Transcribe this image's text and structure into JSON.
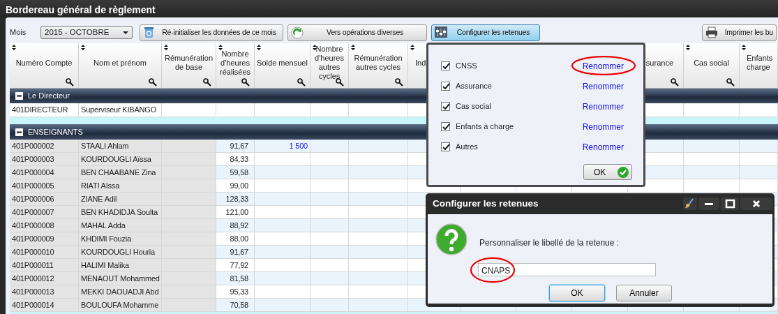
{
  "window": {
    "title": "Bordereau général de règlement"
  },
  "toolbar": {
    "month_label": "Mois",
    "month_value": "2015 - OCTOBRE",
    "buttons": [
      {
        "kind": "reset",
        "label": "Ré-initialiser les données de ce mois",
        "pressed": false
      },
      {
        "kind": "operations",
        "label": "Vers opérations diverses",
        "pressed": false
      },
      {
        "kind": "deductions",
        "label": "Configurer les retenues",
        "pressed": true
      },
      {
        "kind": "print",
        "label": "Imprimer les bu",
        "pressed": false
      }
    ]
  },
  "table": {
    "columns": [
      {
        "label": "Numéro Compte"
      },
      {
        "label": "Nom et prénom"
      },
      {
        "label": "Rémunération de base"
      },
      {
        "label": "Nombre d'heures réalisées"
      },
      {
        "label": "Solde mensuel"
      },
      {
        "label": "Nombre d'heures autres cycles"
      },
      {
        "label": "Rémunération autres cycles"
      },
      {
        "label": "Ind",
        "cut": true
      },
      null,
      null,
      null,
      {
        "label": "surance",
        "cut": true
      },
      {
        "label": "Cas social"
      },
      {
        "label": "Enfants charge",
        "cut": true
      }
    ],
    "groups": [
      {
        "label": "Le Directeur",
        "expanded": true,
        "rows": [
          {
            "account": "401DIRECTEUR",
            "name": "Superviseur KIBANGO"
          }
        ]
      },
      {
        "label": "ENSEIGNANTS",
        "expanded": true,
        "rows": [
          {
            "account": "401P000002",
            "name": "STAALI Ahlam",
            "hours": "91,67",
            "solde": "1 500"
          },
          {
            "account": "401P000003",
            "name": "KOURDOUGLI Aïssa",
            "hours": "84,33"
          },
          {
            "account": "401P000004",
            "name": "BEN CHAABANE Zina",
            "hours": "59,58"
          },
          {
            "account": "401P000005",
            "name": "RIATI Aïssa",
            "hours": "99,00"
          },
          {
            "account": "401P000006",
            "name": "ZIANE Adil",
            "hours": "128,33"
          },
          {
            "account": "401P000007",
            "name": "BEN KHADIDJA Soulta",
            "hours": "121,00"
          },
          {
            "account": "401P000008",
            "name": "MAHAL Adda",
            "hours": "88,92"
          },
          {
            "account": "401P000009",
            "name": "KHDIMI Fouzia",
            "hours": "88,00"
          },
          {
            "account": "401P000010",
            "name": "KOURDOUGLI Houria",
            "hours": "91,67"
          },
          {
            "account": "401P000011",
            "name": "HALIMI Malika",
            "hours": "77,92"
          },
          {
            "account": "401P000012",
            "name": "MENAOUT Mohammed",
            "hours": "81,58"
          },
          {
            "account": "401P000013",
            "name": "MEKKI DAOUADJI Abd",
            "hours": "95,33"
          },
          {
            "account": "401P000014",
            "name": "BOULOUFA Mohamme",
            "hours": "70,58"
          }
        ]
      }
    ]
  },
  "deductions_popup": {
    "items": [
      {
        "label": "CNSS",
        "checked": true,
        "link": "Renommer",
        "circled": true
      },
      {
        "label": "Assurance",
        "checked": true,
        "link": "Renommer",
        "circled": false
      },
      {
        "label": "Cas social",
        "checked": true,
        "link": "Renommer",
        "circled": false
      },
      {
        "label": "Enfants à charge",
        "checked": true,
        "link": "Renommer",
        "circled": false
      },
      {
        "label": "Autres",
        "checked": true,
        "link": "Renommer",
        "circled": false
      }
    ],
    "ok_button": "OK"
  },
  "dialog": {
    "title": "Configurer les retenues",
    "message": "Personnaliser le libellé de la retenue :",
    "field_value": "CNAPS",
    "field_circled": true,
    "buttons": [
      {
        "label": "OK",
        "focused": true
      },
      {
        "label": "Annuler",
        "focused": false
      }
    ]
  }
}
